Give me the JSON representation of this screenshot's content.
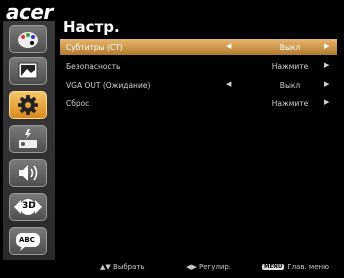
{
  "brand": "acer",
  "title": "Настр.",
  "nav": [
    {
      "name": "palette-icon",
      "label": ""
    },
    {
      "name": "picture-icon",
      "label": ""
    },
    {
      "name": "gear-icon",
      "label": "",
      "selected": true
    },
    {
      "name": "projector-power-icon",
      "label": ""
    },
    {
      "name": "speaker-icon",
      "label": ""
    },
    {
      "name": "3d-icon",
      "label": "3D"
    },
    {
      "name": "language-icon",
      "label": "ABC"
    }
  ],
  "rows": [
    {
      "label": "Субтитры (CT)",
      "value": "Выкл",
      "left_arrow": "◀",
      "right_arrow": "▶",
      "selected": true
    },
    {
      "label": "Безопасность",
      "value": "Нажмите",
      "left_arrow": "",
      "right_arrow": "▶"
    },
    {
      "label": "VGA OUT (Ожидание)",
      "value": "Выкл",
      "left_arrow": "◀",
      "right_arrow": "▶"
    },
    {
      "label": "Сброс",
      "value": "Нажмите",
      "left_arrow": "",
      "right_arrow": "▶"
    }
  ],
  "footer": {
    "select_icon": "▲▼",
    "select_label": "Выбрать",
    "adjust_icon": "◀▶",
    "adjust_label": "Регулир.",
    "menu_key": "MENU",
    "menu_label": "Глав. меню"
  },
  "colors": {
    "selected_row": "#d89a48",
    "selected_nav": "#e8a638",
    "background": "#000000"
  }
}
